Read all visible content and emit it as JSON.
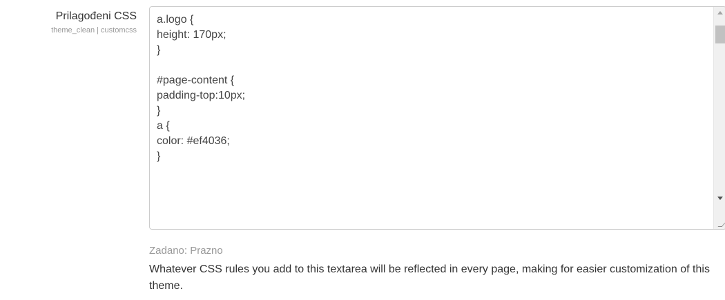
{
  "setting": {
    "title": "Prilagođeni CSS",
    "identifier": "theme_clean | customcss"
  },
  "textarea": {
    "value": "a.logo {\nheight: 170px;\n}\n\n#page-content {\npadding-top:10px;\n}\na {\ncolor: #ef4036;\n}"
  },
  "default_text": "Zadano: Prazno",
  "description": "Whatever CSS rules you add to this textarea will be reflected in every page, making for easier customization of this theme.",
  "icons": {
    "scroll_up": "scroll-up-arrow-icon",
    "scroll_down": "scroll-down-arrow-icon",
    "resize": "resize-grip-icon"
  }
}
